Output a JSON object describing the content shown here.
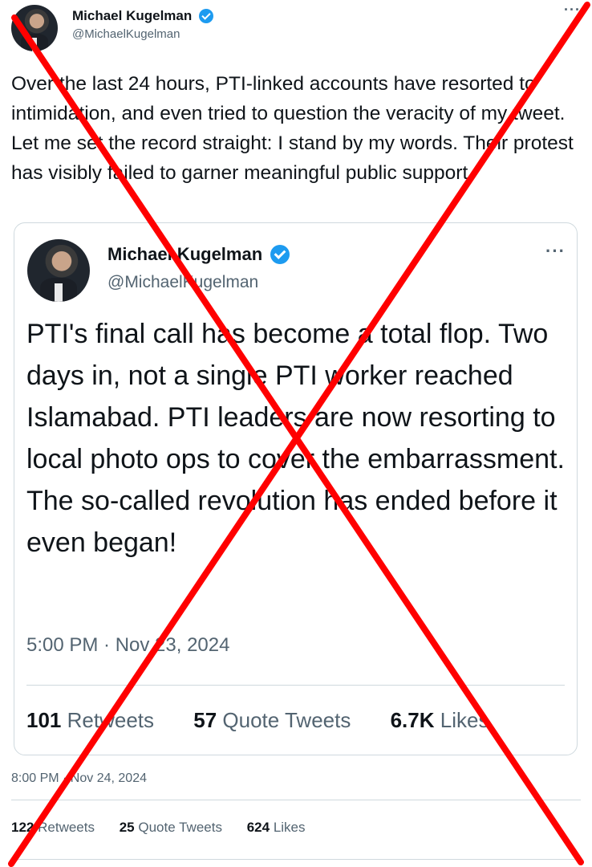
{
  "outer_tweet": {
    "display_name": "Michael Kugelman",
    "handle": "@MichaelKugelman",
    "text": "Over the last 24 hours, PTI-linked accounts have resorted to intimidation, and even tried to question the veracity of my tweet. Let me set the record straight: I stand by my words. Their protest has visibly failed to garner meaningful public support.",
    "more_label": "···",
    "timestamp": "8:00 PM · Nov 24, 2024",
    "stats": {
      "retweets_count": "122",
      "retweets_label": "Retweets",
      "quote_count": "25",
      "quote_label": "Quote Tweets",
      "likes_count": "624",
      "likes_label": "Likes"
    }
  },
  "quoted_tweet": {
    "display_name": "Michael Kugelman",
    "handle": "@MichaelKugelman",
    "more_label": "···",
    "text": "PTI's final call has become a total flop. Two days in, not a single PTI worker reached Islamabad. PTI leaders are now resorting to local photo ops to cover the embarrassment. The so-called revolution has ended before it even began!",
    "timestamp": "5:00 PM · Nov 23, 2024",
    "stats": {
      "retweets_count": "101",
      "retweets_label": "Retweets",
      "quote_count": "57",
      "quote_label": "Quote Tweets",
      "likes_count": "6.7K",
      "likes_label": "Likes"
    }
  },
  "overlay": {
    "type": "red-x-cross",
    "color": "#ff0000"
  },
  "colors": {
    "verified": "#1d9bf0",
    "secondary_text": "#536471",
    "border": "#cfd9de"
  }
}
